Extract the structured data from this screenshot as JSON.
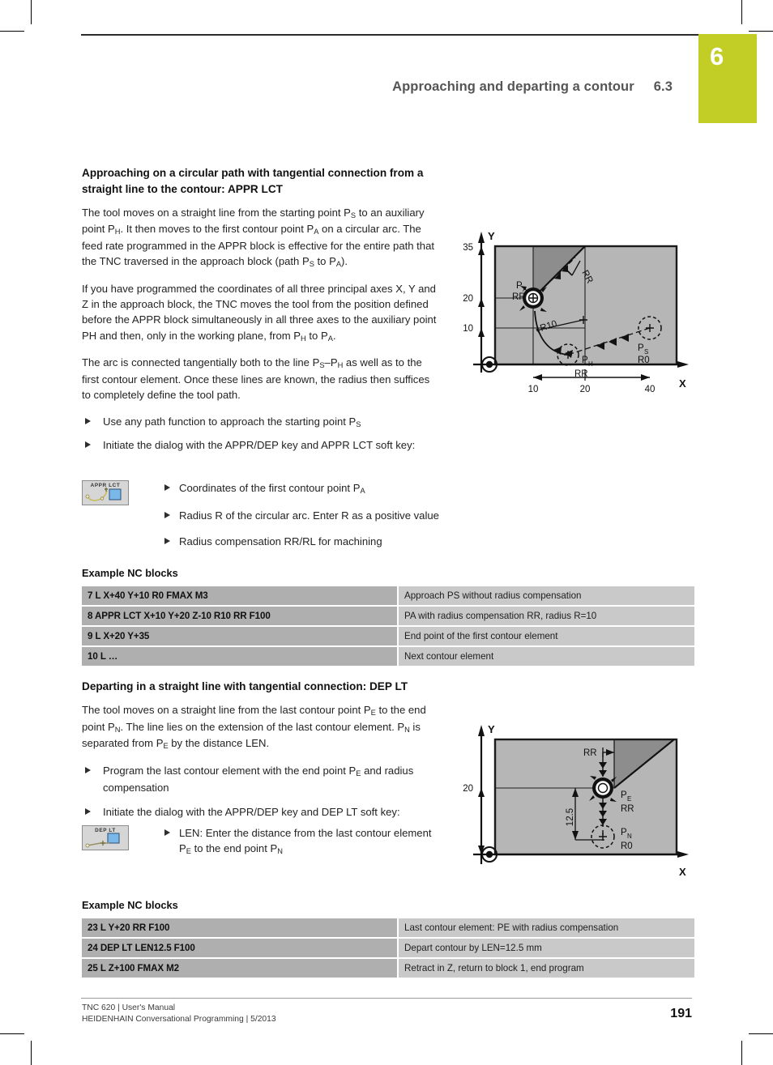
{
  "chapter_tab": {
    "number": "6",
    "color": "#c2ce25"
  },
  "header": {
    "title": "Approaching and departing a contour",
    "section": "6.3"
  },
  "section_appr": {
    "heading": "Approaching on a circular path with tangential connection from a straight line to the contour: APPR LCT",
    "para1_a": "The tool moves on a straight line from the starting point P",
    "para1_s1": "S",
    "para1_b": " to an auxiliary point P",
    "para1_s2": "H",
    "para1_c": ". It then moves to the first contour point P",
    "para1_s3": "A",
    "para1_d": " on a circular arc. The feed rate programmed in the APPR block is effective for the entire path that the TNC traversed in the approach block (path P",
    "para1_s4": "S",
    "para1_e": " to P",
    "para1_s5": "A",
    "para1_f": ").",
    "para2_a": "If you have programmed the coordinates of all three principal axes X, Y and Z in the approach block, the TNC moves the tool from the position defined before the APPR block simultaneously in all three axes to the auxiliary point PH and then, only in the working plane, from P",
    "para2_s1": "H",
    "para2_b": " to P",
    "para2_s2": "A",
    "para2_c": ".",
    "para3_a": "The arc is connected tangentially both to the line P",
    "para3_s1": "S",
    "para3_b": "–P",
    "para3_s2": "H",
    "para3_c": " as well as to the first contour element. Once these lines are known, the radius then suffices to completely define the tool path.",
    "bullets": [
      {
        "text_a": "Use any path function to approach the starting point P",
        "sub": "S",
        "text_b": ""
      },
      {
        "text_a": "Initiate the dialog with the APPR/DEP key and APPR LCT soft key:",
        "sub": "",
        "text_b": ""
      }
    ],
    "softkey": {
      "label": "APPR LCT",
      "name": "appr-lct-softkey"
    },
    "sub_bullets": [
      {
        "text_a": "Coordinates of the first contour point P",
        "sub": "A",
        "text_b": ""
      },
      {
        "text_a": "Radius R of the circular arc. Enter R as a positive value",
        "sub": "",
        "text_b": ""
      },
      {
        "text_a": "Radius compensation RR/RL for machining",
        "sub": "",
        "text_b": ""
      }
    ],
    "nc_title": "Example NC blocks",
    "nc_rows": [
      {
        "code": "7 L X+40 Y+10 R0 FMAX M3",
        "desc": "Approach PS without radius compensation"
      },
      {
        "code": "8 APPR LCT X+10 Y+20 Z-10 R10 RR F100",
        "desc": "PA with radius compensation RR, radius R=10"
      },
      {
        "code": "9 L X+20 Y+35",
        "desc": "End point of the first contour element"
      },
      {
        "code": "10 L …",
        "desc": "Next contour element"
      }
    ]
  },
  "section_dep": {
    "heading": "Departing in a straight line with tangential connection: DEP LT",
    "para1_a": "The tool moves on a straight line from the last contour point P",
    "para1_s1": "E",
    "para1_b": " to the end point P",
    "para1_s2": "N",
    "para1_c": ". The line lies on the extension of the last contour element. P",
    "para1_s3": "N",
    "para1_d": " is separated from P",
    "para1_s4": "E",
    "para1_e": " by the distance LEN.",
    "bullets": [
      {
        "text_a": "Program the last contour element with the end point P",
        "sub": "E",
        "text_b": " and radius compensation"
      },
      {
        "text_a": "Initiate the dialog with the APPR/DEP key and DEP LT soft key:",
        "sub": "",
        "text_b": ""
      }
    ],
    "softkey": {
      "label": "DEP LT",
      "name": "dep-lt-softkey"
    },
    "sub_bullets": [
      {
        "text_a": "LEN: Enter the distance from the last contour element P",
        "sub": "E",
        "text_b": " to the end point P",
        "sub2": "N"
      }
    ],
    "nc_title": "Example NC blocks",
    "nc_rows": [
      {
        "code": "23 L Y+20 RR F100",
        "desc": "Last contour element: PE with radius compensation"
      },
      {
        "code": "24 DEP LT LEN12.5 F100",
        "desc": "Depart contour by LEN=12.5 mm"
      },
      {
        "code": "25 L Z+100 FMAX M2",
        "desc": "Retract in Z, return to block 1, end program"
      }
    ]
  },
  "figure_appr": {
    "axis_y": "Y",
    "axis_x": "X",
    "y_ticks": [
      "35",
      "20",
      "10"
    ],
    "x_ticks": [
      "10",
      "20",
      "40"
    ],
    "labels": {
      "pa": "P",
      "pa_sub": "A",
      "pa_comp": "RR",
      "ps": "P",
      "ps_sub": "S",
      "ps_comp": "R0",
      "ph": "P",
      "ph_sub": "H",
      "ph_comp": "RR",
      "radius": "R10",
      "rr_path": "RR"
    }
  },
  "figure_dep": {
    "axis_y": "Y",
    "axis_x": "X",
    "y_ticks": [
      "20"
    ],
    "labels": {
      "pe": "P",
      "pe_sub": "E",
      "pe_comp": "RR",
      "pn": "P",
      "pn_sub": "N",
      "pn_comp": "R0",
      "rr_top": "RR",
      "len": "12.5"
    }
  },
  "footer": {
    "line1": "TNC 620 | User's Manual",
    "line2": "HEIDENHAIN Conversational Programming | 5/2013",
    "page_number": "191"
  }
}
